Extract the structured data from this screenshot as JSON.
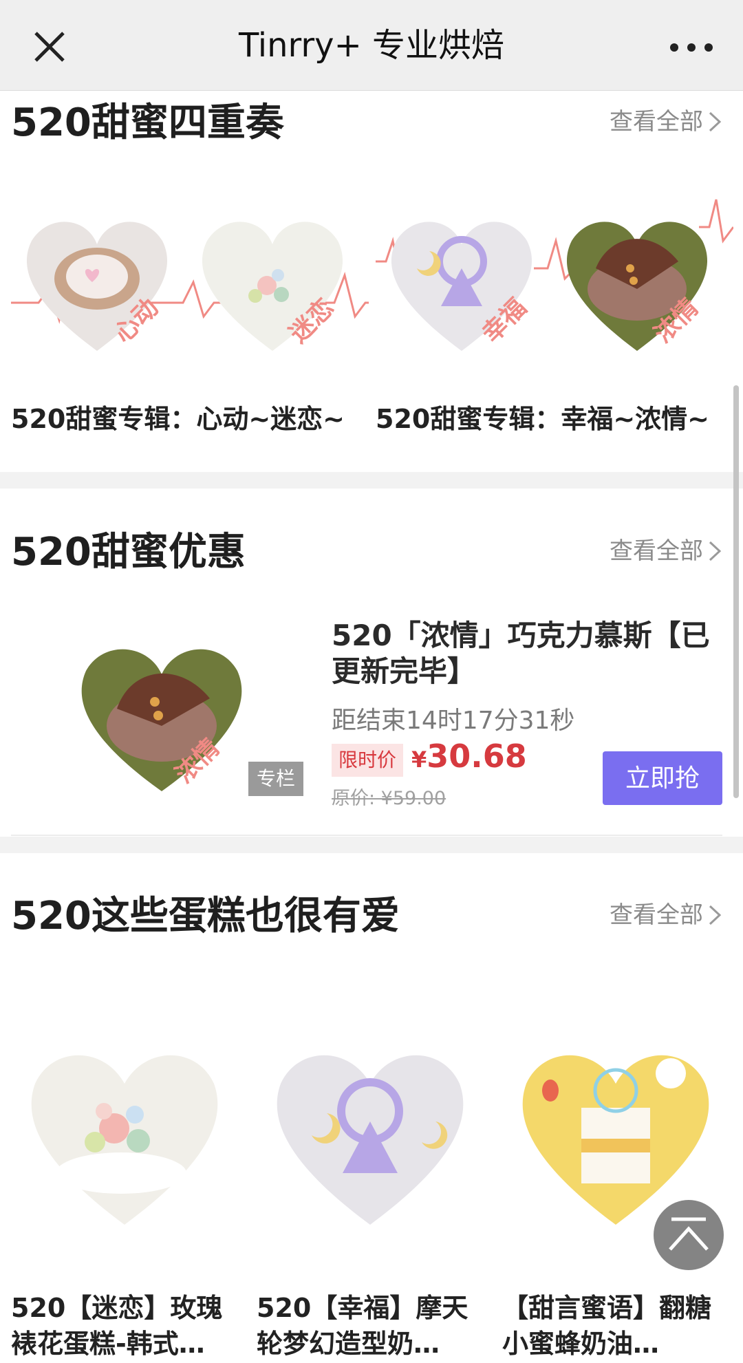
{
  "header": {
    "title": "Tinrry+ 专业烘焙",
    "close_icon": "close-icon",
    "more_icon": "more-icon"
  },
  "sections": {
    "quartet": {
      "title": "520甜蜜四重奏",
      "see_all": "查看全部",
      "albums": [
        {
          "caption": "520甜蜜专辑：心动~迷恋~",
          "stamps": [
            "心动",
            "迷恋"
          ]
        },
        {
          "caption": "520甜蜜专辑：幸福~浓情~",
          "stamps": [
            "幸福",
            "浓情"
          ]
        }
      ]
    },
    "deals": {
      "title": "520甜蜜优惠",
      "see_all": "查看全部",
      "item": {
        "name": "520「浓情」巧克力慕斯【已更新完毕】",
        "thumb_stamp": "浓情",
        "badge": "专栏",
        "countdown": "距结束14时17分31秒",
        "limit_label": "限时价",
        "currency": "¥",
        "price": "30.68",
        "original_price": "原价: ¥59.00",
        "buy_label": "立即抢"
      }
    },
    "more_cakes": {
      "title": "520这些蛋糕也很有爱",
      "see_all": "查看全部",
      "cakes": [
        {
          "name": "520【迷恋】玫瑰裱花蛋糕-韩式…"
        },
        {
          "name": "520【幸福】摩天轮梦幻造型奶…"
        },
        {
          "name": "【甜言蜜语】翻糖小蜜蜂奶油…"
        }
      ]
    }
  },
  "colors": {
    "accent_button": "#7a6ef0",
    "price_red": "#d63a3f",
    "stamp_pink": "#f08a84",
    "topbar_bg": "#efefef"
  }
}
